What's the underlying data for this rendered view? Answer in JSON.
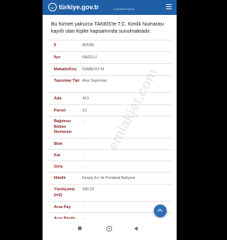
{
  "header": {
    "brand": "türkiye.gov.tr",
    "sub": "e-Devletin kapısı"
  },
  "intro": "Bu hizmet yalnızca TAKBİS'te T.C. Kimlik Numarası kayıtlı olan kişiler kapsamında sunulmaktadır.",
  "rows": [
    {
      "label": "İl",
      "value": "AYDIN"
    },
    {
      "label": "İlçe",
      "value": "NAZİLLİ"
    },
    {
      "label": "Mahalle/Köy",
      "value": "İSABEYLİ M"
    },
    {
      "label": "Taşınmaz Tipi",
      "value": "Ana Taşınmaz"
    },
    {
      "label": "Ada",
      "value": "413"
    },
    {
      "label": "Parsel",
      "value": "13"
    },
    {
      "label": "Bağımsız Bölüm Numarası",
      "value": "-"
    },
    {
      "label": "Blok",
      "value": "-"
    },
    {
      "label": "Kat",
      "value": "-"
    },
    {
      "label": "Giriş",
      "value": "-"
    },
    {
      "label": "Nitelik",
      "value": "Kerpiç Ev Ve Portakal Bahçesi"
    },
    {
      "label": "Yüzölçümü (m2)",
      "value": "330.22"
    },
    {
      "label": "Arsa Pay",
      "value": "-"
    },
    {
      "label": "Arsa Payda",
      "value": "-"
    }
  ],
  "watermark": "emlakjet.com",
  "icons": {
    "menu": "hamburger-menu-icon",
    "scroll_top": "chevron-up-icon",
    "nav_recent": "square-icon",
    "nav_home": "circle-icon",
    "nav_back": "triangle-back-icon"
  }
}
